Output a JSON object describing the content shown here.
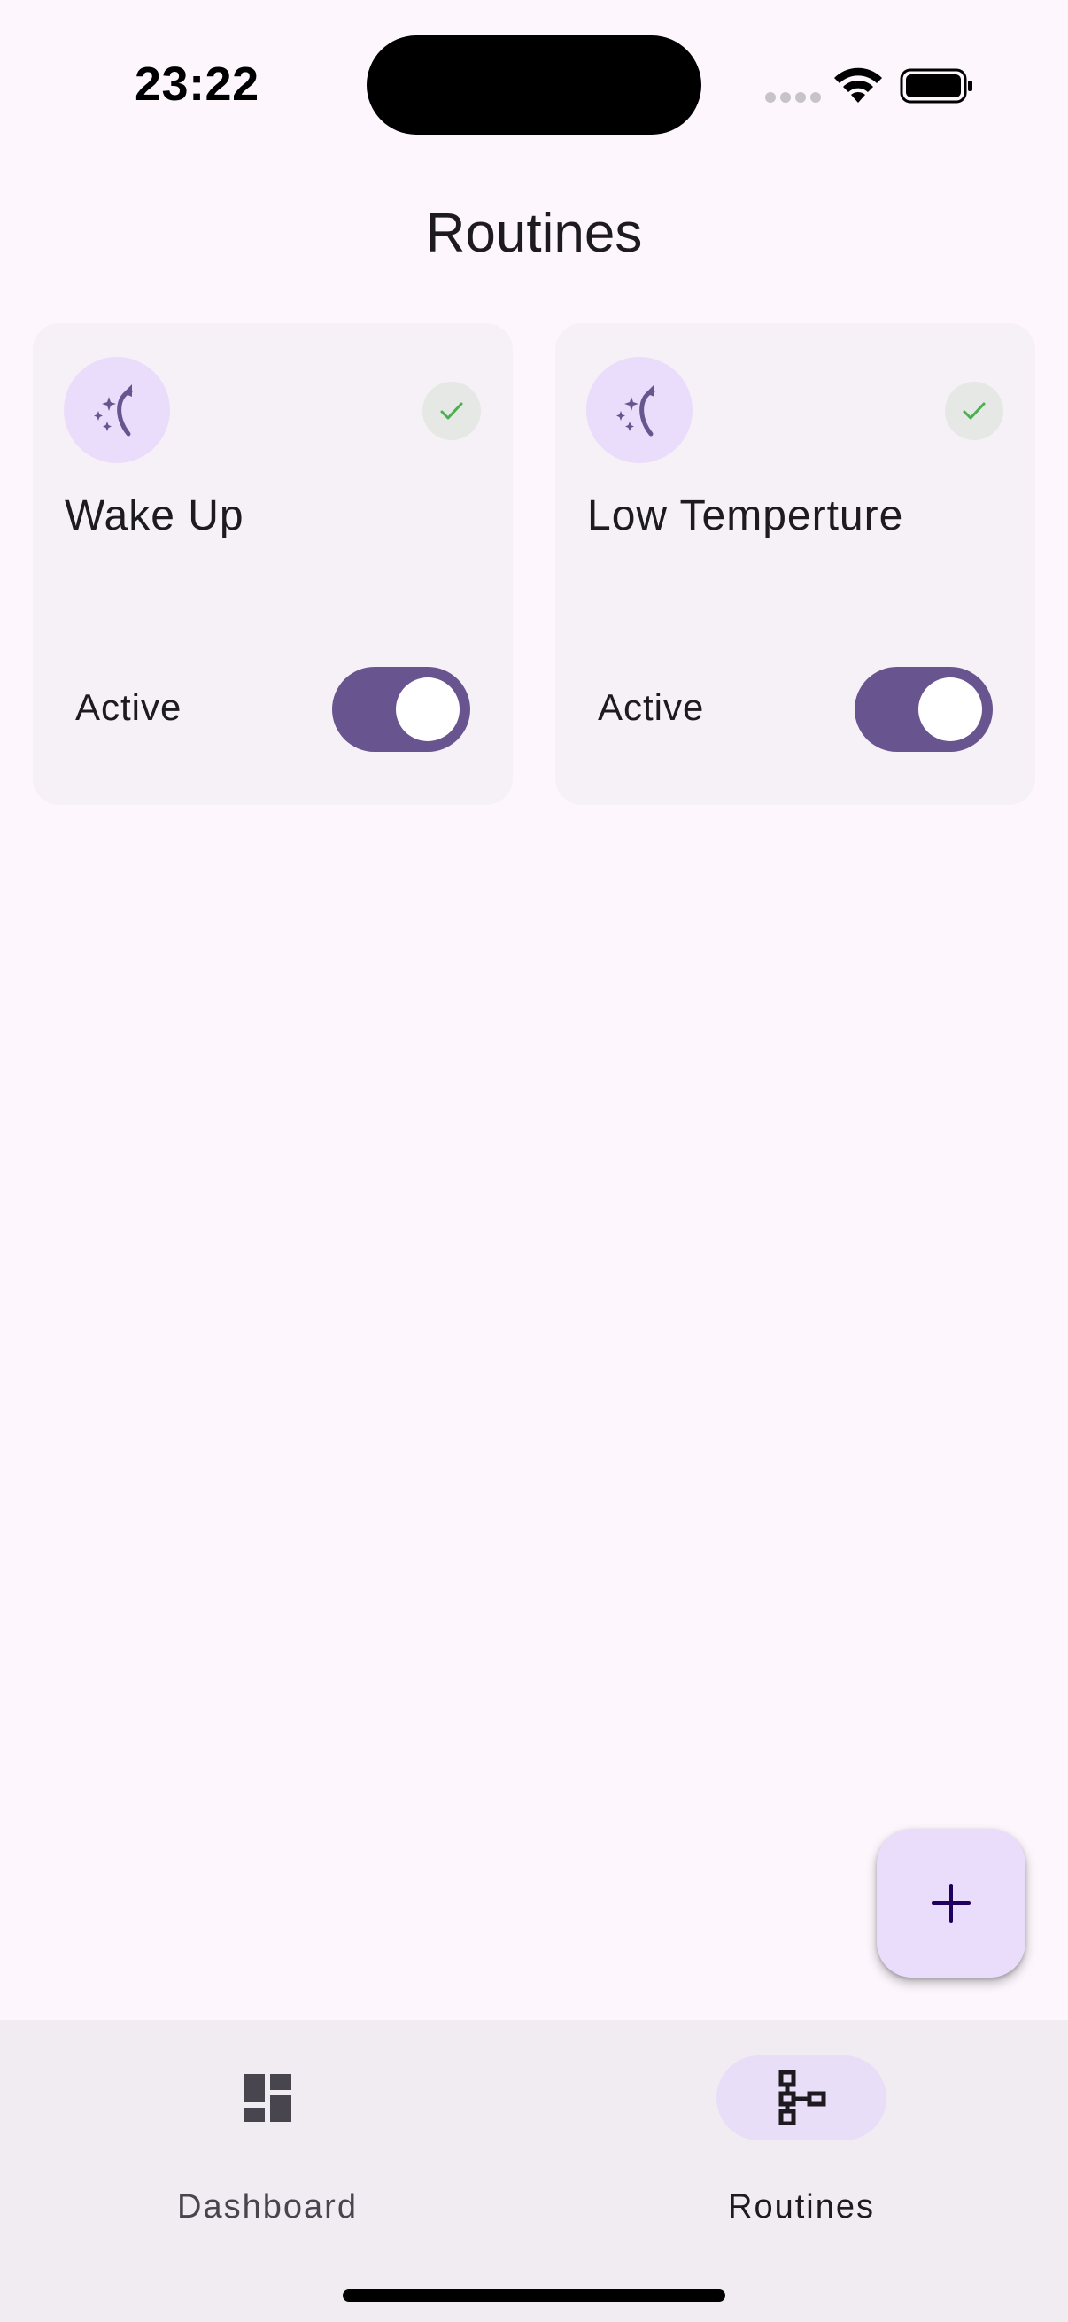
{
  "status_bar": {
    "time": "23:22",
    "icons": [
      "signal-icon",
      "wifi-icon",
      "battery-icon"
    ]
  },
  "header": {
    "title": "Routines"
  },
  "routines": [
    {
      "name": "Wake Up",
      "icon": "routine-night-icon",
      "status_icon": "check-icon",
      "toggle_label": "Active",
      "active": true
    },
    {
      "name": "Low Temperture",
      "icon": "routine-night-icon",
      "status_icon": "check-icon",
      "toggle_label": "Active",
      "active": true
    }
  ],
  "fab": {
    "icon": "plus-icon"
  },
  "bottom_nav": {
    "items": [
      {
        "label": "Dashboard",
        "icon": "dashboard-icon",
        "selected": false
      },
      {
        "label": "Routines",
        "icon": "routines-icon",
        "selected": true
      }
    ]
  },
  "colors": {
    "background": "#fdf7fd",
    "card": "#f6f1f6",
    "primary": "#685590",
    "primary_container": "#eaddfc",
    "success": "#4caf50",
    "nav_bar": "#f1ecf2"
  }
}
